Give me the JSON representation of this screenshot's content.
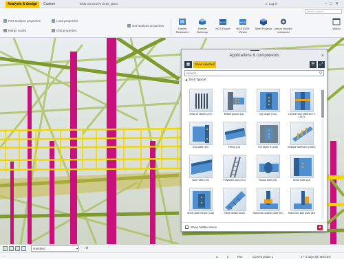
{
  "titlebar": {
    "tabs": [
      "Analysis & design",
      "Custom"
    ],
    "window_title": "Tekla Structures  Zenit_plant",
    "user": "Log in",
    "quick_launch_placeholder": "Quick Launch"
  },
  "ribbon": {
    "small_commands": [
      "Part analysis properties",
      "Load properties",
      "Merge nodes",
      "Get analysis properties",
      "Grid properties"
    ],
    "big_buttons": [
      {
        "label": "Trimble Realworks",
        "icon": "realworks-icon"
      },
      {
        "label": "Trimble Sketchup",
        "icon": "sketchup-icon"
      },
      {
        "label": "NGS Export",
        "icon": "ngs-export-icon"
      },
      {
        "label": "NGS IDSS Viewer",
        "icon": "viewer-icon"
      },
      {
        "label": "Steel Projects",
        "icon": "steel-projects-icon"
      },
      {
        "label": "Macro (model) advanced",
        "icon": "gear-icon"
      },
      {
        "label": "Windo",
        "icon": "window-icon"
      }
    ]
  },
  "panel": {
    "title": "Applications & components",
    "show_selected": "Show selected",
    "search_placeholder": "Search...",
    "category": "Zenit Typical",
    "items": [
      {
        "label": "Array of objects (29)",
        "icon": "array-icon"
      },
      {
        "label": "Bolted gusset (11)",
        "icon": "bolted-gusset-icon"
      },
      {
        "label": "Clip angle (141)",
        "icon": "clip-angle-icon"
      },
      {
        "label": "Column with stiffeners S (187)",
        "icon": "column-stiffener-icon"
      },
      {
        "label": "End plate (29)",
        "icon": "end-plate-icon"
      },
      {
        "label": "Fitting (13)",
        "icon": "fitting-icon"
      },
      {
        "label": "Full depth S (185)",
        "icon": "full-depth-icon"
      },
      {
        "label": "Multiple Stiffeners (1064)",
        "icon": "multiple-stiffeners-icon"
      },
      {
        "label": "New notch (49)",
        "icon": "new-notch-icon"
      },
      {
        "label": "Polybeam pan (573)",
        "icon": "polybeam-icon"
      },
      {
        "label": "Round tube (23)",
        "icon": "round-tube-icon"
      },
      {
        "label": "Shear plate (34)",
        "icon": "shear-plate-icon"
      },
      {
        "label": "Shear plate simple (146)",
        "icon": "shear-plate-simple-icon"
      },
      {
        "label": "Stairs detail (1028)",
        "icon": "stairs-icon"
      },
      {
        "label": "Stanchion double plate (67)",
        "icon": "stanchion-double-icon"
      },
      {
        "label": "Stanchion side plate (83)",
        "icon": "stanchion-side-icon"
      }
    ],
    "show_hidden": "Show hidden items"
  },
  "bottombar": {
    "filter_value": "standard"
  },
  "status": {
    "left": "...",
    "cells": [
      "S",
      "0",
      "Pan",
      "Current phase 1",
      "1 + 0 object(s) selected"
    ]
  },
  "colors": {
    "accent": "#f4c400",
    "magenta_columns": "#c8117a",
    "green_steel": "#9fbd3a",
    "yellow_rail": "#f2d600"
  }
}
